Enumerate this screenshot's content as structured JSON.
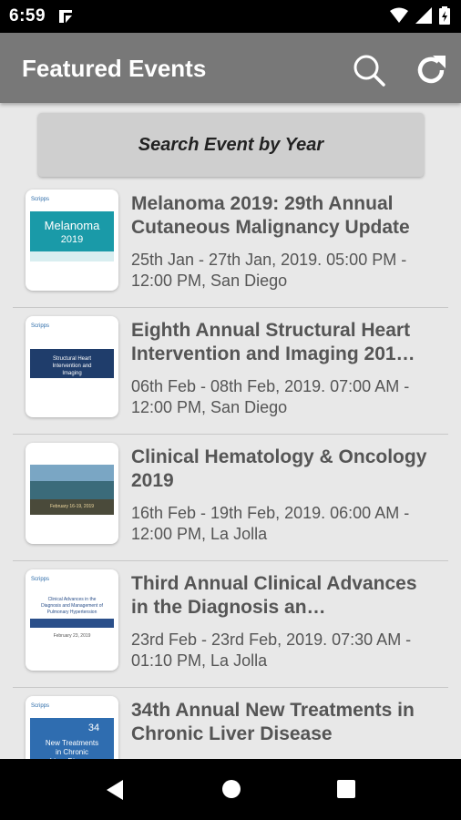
{
  "status_bar": {
    "time": "6:59"
  },
  "app_bar": {
    "title": "Featured Events",
    "search_icon": "search-icon",
    "refresh_icon": "refresh-icon"
  },
  "search_year_button": {
    "label": "Search Event by Year"
  },
  "events": [
    {
      "title": "Melanoma 2019: 29th Annual Cutaneous Malignancy Update",
      "date": "25th Jan - 27th Jan, 2019. 05:00 PM - 12:00 PM, San Diego",
      "thumb_heading": "Melanoma 2019",
      "thumb_color": "#1a9aa8"
    },
    {
      "title": "Eighth Annual Structural Heart Intervention and Imaging 201…",
      "date": "06th Feb - 08th Feb, 2019. 07:00 AM - 12:00 PM, San Diego",
      "thumb_heading": "Structural Heart Intervention and Imaging",
      "thumb_color": "#1f3d6b"
    },
    {
      "title": "Clinical Hematology & Oncology 2019",
      "date": "16th Feb - 19th Feb, 2019. 06:00 AM - 12:00 PM, La Jolla",
      "thumb_heading": "Clinical Hematology & Oncology",
      "thumb_color": "#3b6b7a"
    },
    {
      "title": "Third Annual Clinical Advances in the Diagnosis an…",
      "date": "23rd Feb - 23rd Feb, 2019. 07:30 AM - 01:10 PM, La Jolla",
      "thumb_heading": "Clinical Advances in the Diagnosis and Management of Pulmonary Hypertension",
      "thumb_color": "#2a4f8a"
    },
    {
      "title": "34th Annual New Treatments in Chronic Liver Disease",
      "date": "",
      "thumb_heading": "New Treatments in Chronic Liver Disease",
      "thumb_color": "#2f6db0"
    }
  ],
  "thumb_logo_text": "Scripps",
  "colors": {
    "app_bar": "#787878",
    "background": "#e8e8e8"
  }
}
